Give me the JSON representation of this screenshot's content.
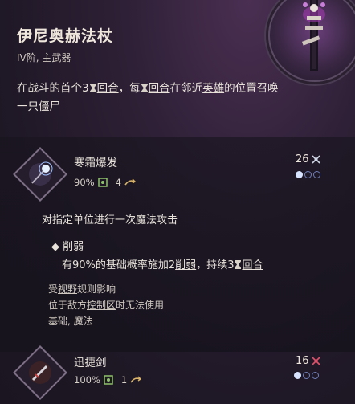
{
  "item": {
    "title": "伊尼奥赫法杖",
    "subtitle": "IV阶, 主武器",
    "desc_part1": "在战斗的首个3",
    "desc_round1": "回合",
    "desc_part2": "，每",
    "desc_round2": "回合",
    "desc_part3": "在邻近",
    "desc_hero": "英雄",
    "desc_part4": "的位置召唤",
    "desc_line2": "一只僵尸"
  },
  "skill1": {
    "name": "寒霜爆发",
    "hit_chance": "90%",
    "range": "4",
    "cost": "26",
    "dots": [
      true,
      false,
      false
    ],
    "description": "对指定单位进行一次魔法攻击",
    "effect_name": "削弱",
    "effect_p1": "有90%的基础概率施加2",
    "effect_weaken": "削弱",
    "effect_p2": "，持续3",
    "effect_round": "回合",
    "tag1_p1": "受",
    "tag1_link": "视野",
    "tag1_p2": "规则影响",
    "tag2_p1": "位于敌方",
    "tag2_link": "控制区",
    "tag2_p2": "时无法使用",
    "tag3": "基础, 魔法"
  },
  "skill2": {
    "name": "迅捷剑",
    "hit_chance": "100%",
    "range": "1",
    "cost": "16",
    "dots": [
      true,
      false,
      false
    ]
  },
  "colors": {
    "accent_blue": "#d8e4ff",
    "icon_green": "#8fc26b",
    "icon_gold": "#d8b36a",
    "cost_red": "#e0506a"
  }
}
